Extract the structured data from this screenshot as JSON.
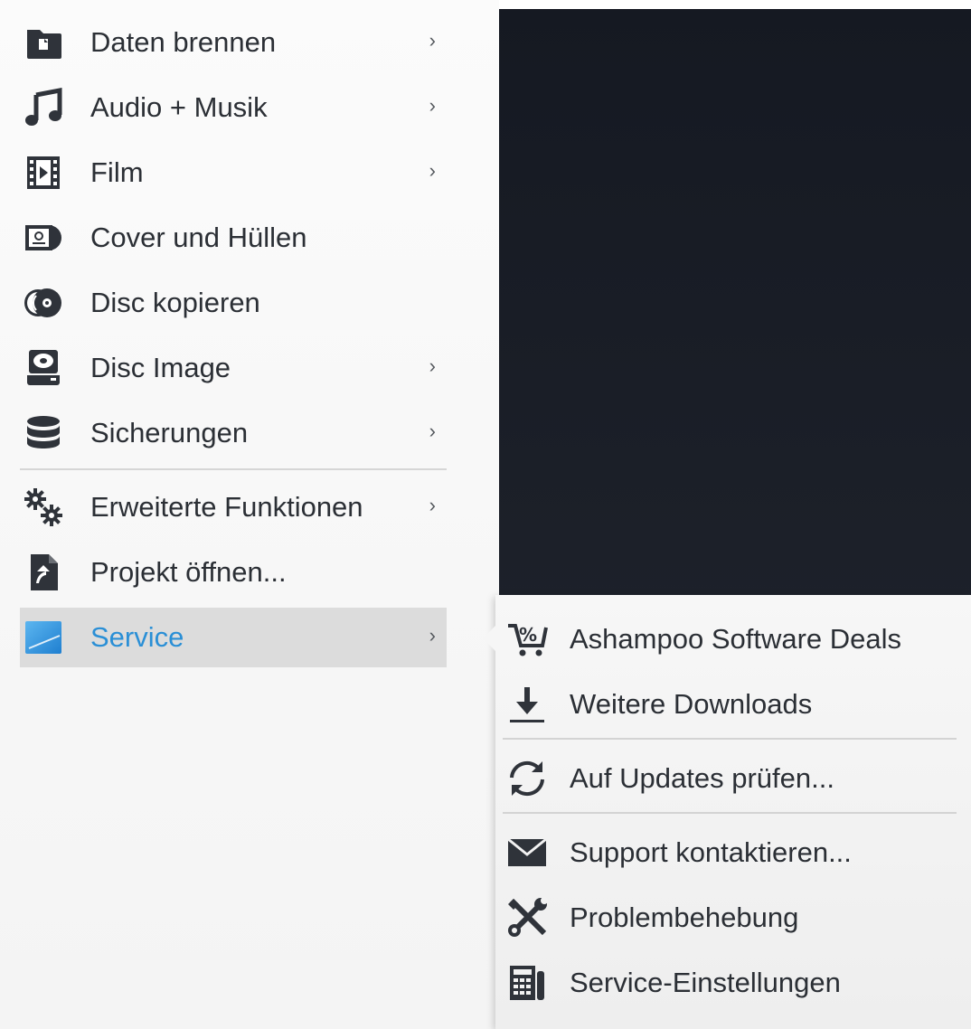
{
  "main_menu": {
    "items": [
      {
        "label": "Daten brennen",
        "icon": "folder-icon",
        "submenu": true
      },
      {
        "label": "Audio + Musik",
        "icon": "music-note-icon",
        "submenu": true
      },
      {
        "label": "Film",
        "icon": "film-icon",
        "submenu": true
      },
      {
        "label": "Cover und Hüllen",
        "icon": "cover-icon",
        "submenu": false
      },
      {
        "label": "Disc kopieren",
        "icon": "disc-copy-icon",
        "submenu": false
      },
      {
        "label": "Disc Image",
        "icon": "disc-image-icon",
        "submenu": true
      },
      {
        "label": "Sicherungen",
        "icon": "database-icon",
        "submenu": true
      },
      {
        "label": "Erweiterte Funktionen",
        "icon": "gears-icon",
        "submenu": true
      },
      {
        "label": "Projekt öffnen...",
        "icon": "open-project-icon",
        "submenu": false
      },
      {
        "label": "Service",
        "icon": "service-icon",
        "submenu": true,
        "selected": true
      }
    ],
    "chevron": "›"
  },
  "service_submenu": {
    "items": [
      {
        "label": "Ashampoo Software Deals",
        "icon": "deals-cart-icon"
      },
      {
        "label": "Weitere Downloads",
        "icon": "download-icon"
      },
      {
        "label": "Auf Updates prüfen...",
        "icon": "refresh-icon"
      },
      {
        "label": "Support kontaktieren...",
        "icon": "envelope-icon"
      },
      {
        "label": "Problembehebung",
        "icon": "tools-icon"
      },
      {
        "label": "Service-Einstellungen",
        "icon": "service-settings-icon"
      }
    ]
  },
  "colors": {
    "text": "#2b2f35",
    "selected_text": "#2a8fd6",
    "icon": "#2f333a",
    "selected_bg": "#dcdcdc",
    "dark_bg": "#1a1e26"
  }
}
